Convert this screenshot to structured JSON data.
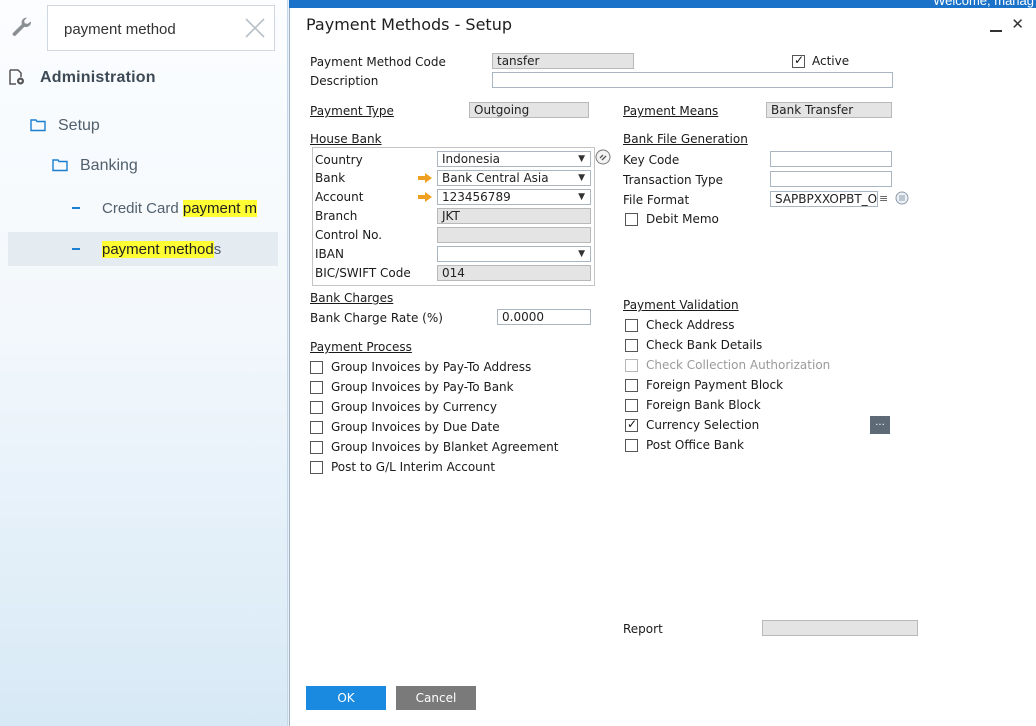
{
  "topbar": {
    "welcome_text": "Welcome, manag"
  },
  "search": {
    "value": "payment method"
  },
  "tree": {
    "administration": "Administration",
    "setup": "Setup",
    "banking": "Banking",
    "credit_card_prefix": "Credit Card ",
    "credit_card_hl": "payment m",
    "pm_hl": "payment method",
    "pm_suffix": "s"
  },
  "dialog": {
    "title": "Payment Methods - Setup",
    "labels": {
      "code": "Payment Method Code",
      "description": "Description",
      "active": "Active",
      "payment_type": "Payment Type",
      "payment_means": "Payment Means",
      "house_bank": "House Bank",
      "bank_file_generation": "Bank File Generation",
      "country": "Country",
      "bank": "Bank",
      "account": "Account",
      "branch": "Branch",
      "control_no": "Control No.",
      "iban": "IBAN",
      "bic": "BIC/SWIFT Code",
      "key_code": "Key Code",
      "transaction_type": "Transaction Type",
      "file_format": "File Format",
      "debit_memo": "Debit Memo",
      "bank_charges": "Bank Charges",
      "bank_charge_rate": "Bank Charge Rate (%)",
      "payment_process": "Payment Process",
      "payment_validation": "Payment Validation",
      "report": "Report"
    },
    "values": {
      "code": "tansfer",
      "description": "",
      "payment_type": "Outgoing",
      "payment_means": "Bank Transfer",
      "country": "Indonesia",
      "bank": "Bank Central Asia",
      "account": "123456789",
      "branch": "JKT",
      "control_no": "",
      "iban": "",
      "bic": "014",
      "key_code": "",
      "transaction_type": "",
      "file_format": "SAPBPXXOPBT_OI",
      "bank_charge_rate": "0.0000",
      "report": ""
    },
    "active_checked": true,
    "payment_process": [
      {
        "label": "Group Invoices by Pay-To Address",
        "checked": false
      },
      {
        "label": "Group Invoices by Pay-To Bank",
        "checked": false
      },
      {
        "label": "Group Invoices by Currency",
        "checked": false
      },
      {
        "label": "Group Invoices by Due Date",
        "checked": false
      },
      {
        "label": "Group Invoices by Blanket Agreement",
        "checked": false
      },
      {
        "label": "Post to G/L Interim Account",
        "checked": false
      }
    ],
    "payment_validation": [
      {
        "label": "Check Address",
        "checked": false,
        "disabled": false
      },
      {
        "label": "Check Bank Details",
        "checked": false,
        "disabled": false
      },
      {
        "label": "Check Collection Authorization",
        "checked": false,
        "disabled": true
      },
      {
        "label": "Foreign Payment Block",
        "checked": false,
        "disabled": false
      },
      {
        "label": "Foreign Bank Block",
        "checked": false,
        "disabled": false
      },
      {
        "label": "Currency Selection",
        "checked": true,
        "disabled": false
      },
      {
        "label": "Post Office Bank",
        "checked": false,
        "disabled": false
      }
    ],
    "ellipsis": "...",
    "ok": "OK",
    "cancel": "Cancel"
  },
  "colors": {
    "accent": "#1a73c8",
    "ok_button": "#1a8ae0",
    "highlight": "#ffff33",
    "link_arrow": "#f0a020"
  }
}
